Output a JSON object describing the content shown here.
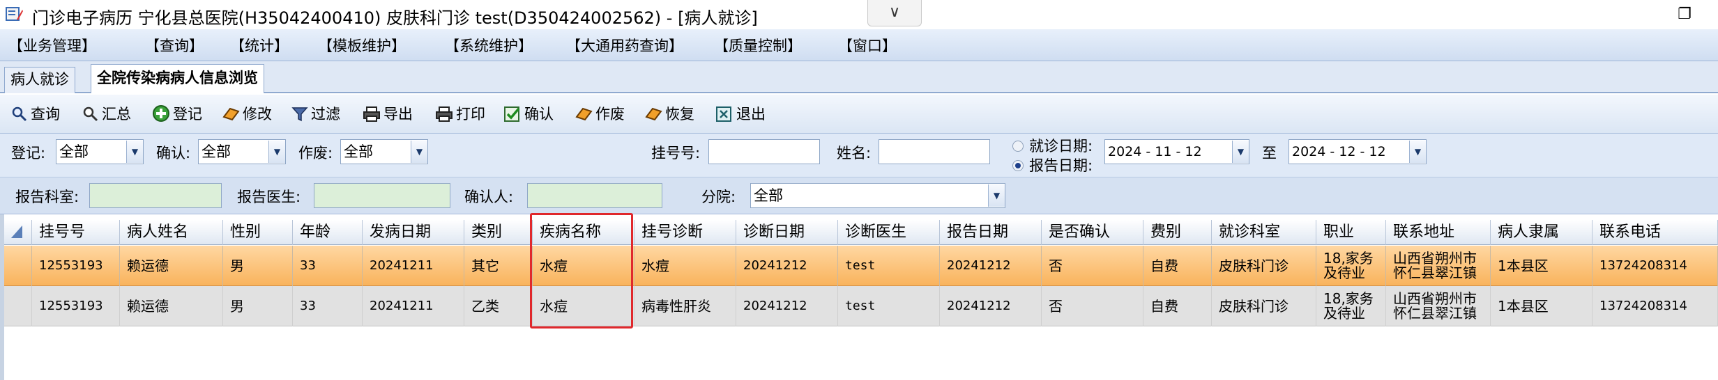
{
  "window": {
    "title": "门诊电子病历  宁化县总医院(H35042400410)  皮肤科门诊  test(D350424002562) - [病人就诊]",
    "dropdown_glyph": "∨",
    "restore_glyph": "❐"
  },
  "menu": [
    "【业务管理】",
    "【查询】",
    "【统计】",
    "【模板维护】",
    "【系统维护】",
    "【大通用药查询】",
    "【质量控制】",
    "【窗口】"
  ],
  "tabs": [
    {
      "label": "病人就诊",
      "active": false
    },
    {
      "label": "全院传染病病人信息浏览",
      "active": true
    }
  ],
  "toolbar": [
    {
      "label": "查询",
      "icon": "magnifier-icon"
    },
    {
      "label": "汇总",
      "icon": "zoom-icon"
    },
    {
      "label": "登记",
      "icon": "add-circle-icon"
    },
    {
      "label": "修改",
      "icon": "eraser-icon"
    },
    {
      "label": "过滤",
      "icon": "funnel-icon"
    },
    {
      "label": "导出",
      "icon": "printer-icon"
    },
    {
      "label": "打印",
      "icon": "printer-icon"
    },
    {
      "label": "确认",
      "icon": "check-icon"
    },
    {
      "label": "作废",
      "icon": "eraser-icon"
    },
    {
      "label": "恢复",
      "icon": "eraser-icon"
    },
    {
      "label": "退出",
      "icon": "exit-icon"
    }
  ],
  "filters": {
    "register_label": "登记:",
    "register_value": "全部",
    "confirm_label": "确认:",
    "confirm_value": "全部",
    "void_label": "作废:",
    "void_value": "全部",
    "regno_label": "挂号号:",
    "regno_value": "",
    "name_label": "姓名:",
    "name_value": "",
    "visit_date_label": "就诊日期:",
    "report_date_label": "报告日期:",
    "selected_date_type": "报告日期",
    "date_from": "2024 - 11 - 12",
    "date_to_label": "至",
    "date_to": "2024 - 12 - 12",
    "report_dept_label": "报告科室:",
    "report_dept_value": "",
    "report_doctor_label": "报告医生:",
    "report_doctor_value": "",
    "confirmer_label": "确认人:",
    "confirmer_value": "",
    "branch_label": "分院:",
    "branch_value": "全部"
  },
  "grid": {
    "columns": [
      "挂号号",
      "病人姓名",
      "性别",
      "年龄",
      "发病日期",
      "类别",
      "疾病名称",
      "挂号诊断",
      "诊断日期",
      "诊断医生",
      "报告日期",
      "是否确认",
      "费别",
      "就诊科室",
      "职业",
      "联系地址",
      "病人隶属",
      "联系电话"
    ],
    "rows": [
      [
        "12553193",
        "赖运德",
        "男",
        "33",
        "20241211",
        "其它",
        "水痘",
        "水痘",
        "20241212",
        "test",
        "20241212",
        "否",
        "自费",
        "皮肤科门诊",
        [
          "18,家务",
          "及待业"
        ],
        [
          "山西省朔州市",
          "怀仁县翠江镇"
        ],
        "1本县区",
        "13724208314"
      ],
      [
        "12553193",
        "赖运德",
        "男",
        "33",
        "20241211",
        "乙类",
        "水痘",
        "病毒性肝炎",
        "20241212",
        "test",
        "20241212",
        "否",
        "自费",
        "皮肤科门诊",
        [
          "18,家务",
          "及待业"
        ],
        [
          "山西省朔州市",
          "怀仁县翠江镇"
        ],
        "1本县区",
        "13724208314"
      ]
    ],
    "selected_row": 0
  },
  "colors": {
    "highlight_box": "#e0282c",
    "selected_row": "#f9b35c"
  }
}
